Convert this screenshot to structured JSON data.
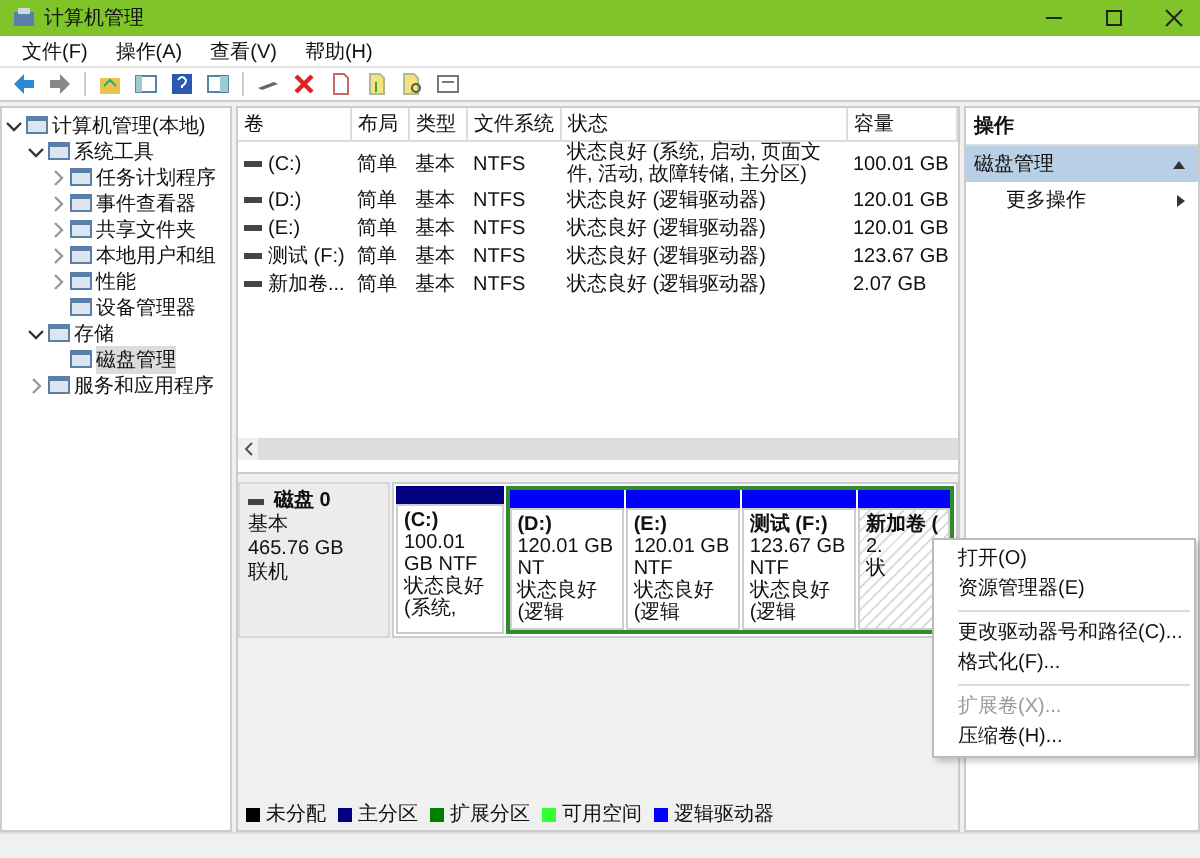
{
  "window": {
    "title": "计算机管理"
  },
  "menu_bar": [
    "文件(F)",
    "操作(A)",
    "查看(V)",
    "帮助(H)"
  ],
  "tree": [
    {
      "label": "计算机管理(本地)",
      "expanded": true,
      "selected": false,
      "children": [
        {
          "label": "系统工具",
          "expanded": true,
          "selected": false,
          "children": [
            {
              "label": "任务计划程序",
              "expanded": false,
              "selected": false
            },
            {
              "label": "事件查看器",
              "expanded": false,
              "selected": false
            },
            {
              "label": "共享文件夹",
              "expanded": false,
              "selected": false
            },
            {
              "label": "本地用户和组",
              "expanded": false,
              "selected": false
            },
            {
              "label": "性能",
              "expanded": false,
              "selected": false
            },
            {
              "label": "设备管理器",
              "selected": false
            }
          ]
        },
        {
          "label": "存储",
          "expanded": true,
          "selected": false,
          "children": [
            {
              "label": "磁盘管理",
              "selected": true
            }
          ]
        },
        {
          "label": "服务和应用程序",
          "expanded": false,
          "selected": false
        }
      ]
    }
  ],
  "volumes": {
    "columns": [
      "卷",
      "布局",
      "类型",
      "文件系统",
      "状态",
      "容量"
    ],
    "rows": [
      [
        "(C:)",
        "简单",
        "基本",
        "NTFS",
        "状态良好 (系统, 启动, 页面文件, 活动, 故障转储, 主分区)",
        "100.01 GB"
      ],
      [
        "(D:)",
        "简单",
        "基本",
        "NTFS",
        "状态良好 (逻辑驱动器)",
        "120.01 GB"
      ],
      [
        "(E:)",
        "简单",
        "基本",
        "NTFS",
        "状态良好 (逻辑驱动器)",
        "120.01 GB"
      ],
      [
        "测试 (F:)",
        "简单",
        "基本",
        "NTFS",
        "状态良好 (逻辑驱动器)",
        "123.67 GB"
      ],
      [
        "新加卷...",
        "简单",
        "基本",
        "NTFS",
        "状态良好 (逻辑驱动器)",
        "2.07 GB"
      ]
    ]
  },
  "disk": {
    "name": "磁盘 0",
    "type": "基本",
    "size": "465.76 GB",
    "status": "联机",
    "partitions": [
      {
        "kind": "primary",
        "name": "(C:)",
        "size": "100.01 GB NTF",
        "status": "状态良好 (系统,",
        "selected": false
      },
      {
        "kind": "logical",
        "name": "(D:)",
        "size": "120.01 GB NT",
        "status": "状态良好 (逻辑",
        "selected": false
      },
      {
        "kind": "logical",
        "name": "(E:)",
        "size": "120.01 GB NTF",
        "status": "状态良好 (逻辑",
        "selected": false
      },
      {
        "kind": "logical",
        "name": "测试 (F:)",
        "size": "123.67 GB NTF",
        "status": "状态良好 (逻辑",
        "selected": false
      },
      {
        "kind": "logical",
        "name": "新加卷 (",
        "size": "2.",
        "status": "状",
        "selected": true
      }
    ]
  },
  "legend": [
    {
      "label": "未分配",
      "color": "#000000"
    },
    {
      "label": "主分区",
      "color": "#000080"
    },
    {
      "label": "扩展分区",
      "color": "#008000"
    },
    {
      "label": "可用空间",
      "color": "#33ff33"
    },
    {
      "label": "逻辑驱动器",
      "color": "#0000ff"
    }
  ],
  "actions": {
    "header": "操作",
    "section": {
      "label": "磁盘管理",
      "selected": true
    },
    "items": [
      "更多操作"
    ]
  },
  "context_menu": [
    {
      "kind": "item",
      "label": "打开(O)",
      "disabled": false
    },
    {
      "kind": "item",
      "label": "资源管理器(E)",
      "disabled": false
    },
    {
      "kind": "separator"
    },
    {
      "kind": "item",
      "label": "更改驱动器号和路径(C)...",
      "disabled": false
    },
    {
      "kind": "item",
      "label": "格式化(F)...",
      "disabled": false
    },
    {
      "kind": "separator"
    },
    {
      "kind": "item",
      "label": "扩展卷(X)...",
      "disabled": true
    },
    {
      "kind": "item",
      "label": "压缩卷(H)...",
      "disabled": false
    }
  ]
}
